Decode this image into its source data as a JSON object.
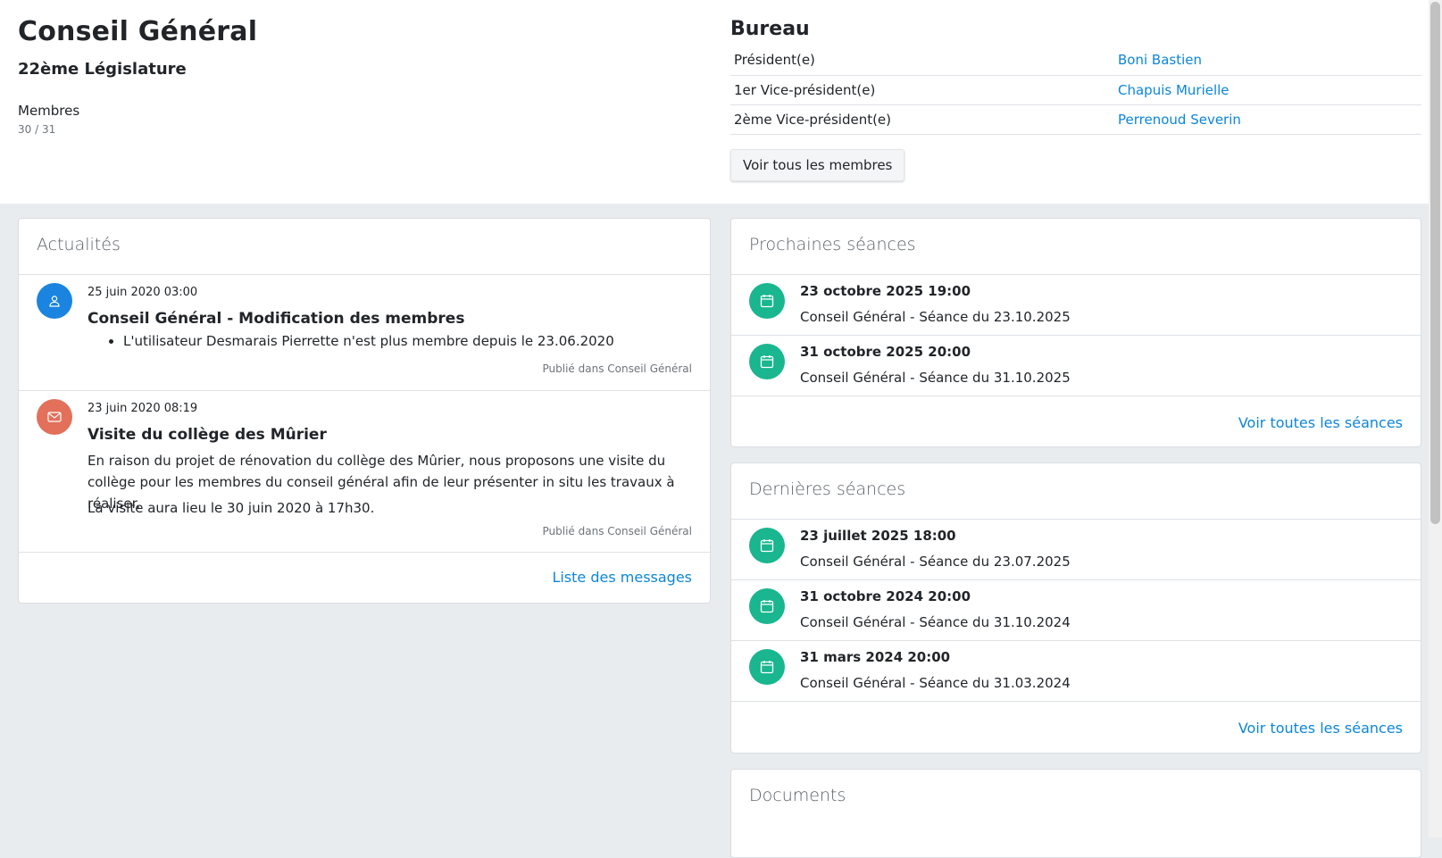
{
  "header": {
    "title": "Conseil Général",
    "legislature": "22ème Législature",
    "members_label": "Membres",
    "members_count": "30 / 31"
  },
  "bureau": {
    "title": "Bureau",
    "rows": [
      {
        "role": "Président(e)",
        "name": "Boni Bastien"
      },
      {
        "role": "1er Vice-président(e)",
        "name": "Chapuis Murielle"
      },
      {
        "role": "2ème Vice-président(e)",
        "name": "Perrenoud Severin"
      }
    ],
    "all_members_button": "Voir tous les membres"
  },
  "news": {
    "title": "Actualités",
    "items": [
      {
        "icon": "user-icon",
        "date": "25 juin 2020 03:00",
        "title": "Conseil Général - Modification des membres",
        "bullet": "L'utilisateur Desmarais Pierrette n'est plus membre depuis le 23.06.2020",
        "published": "Publié dans Conseil Général"
      },
      {
        "icon": "envelope-icon",
        "date": "23 juin 2020 08:19",
        "title": "Visite du collège des Mûrier",
        "text": "En raison du projet de rénovation du collège des Mûrier, nous proposons une visite du collège pour les membres du conseil général afin de leur présenter in situ les travaux à réaliser.",
        "text2": "La visite aura lieu le 30 juin 2020 à 17h30.",
        "published": "Publié dans Conseil Général"
      }
    ],
    "footer_link": "Liste des messages"
  },
  "upcoming": {
    "title": "Prochaines séances",
    "items": [
      {
        "date": "23 octobre 2025 19:00",
        "name": "Conseil Général - Séance du 23.10.2025"
      },
      {
        "date": "31 octobre 2025 20:00",
        "name": "Conseil Général - Séance du 31.10.2025"
      }
    ],
    "footer_link": "Voir toutes les séances"
  },
  "past": {
    "title": "Dernières séances",
    "items": [
      {
        "date": "23 juillet 2025 18:00",
        "name": "Conseil Général - Séance du 23.07.2025"
      },
      {
        "date": "31 octobre 2024 20:00",
        "name": "Conseil Général - Séance du 31.10.2024"
      },
      {
        "date": "31 mars 2024 20:00",
        "name": "Conseil Général - Séance du 31.03.2024"
      }
    ],
    "footer_link": "Voir toutes les séances"
  },
  "documents": {
    "title": "Documents"
  },
  "colors": {
    "link": "#0d86d8",
    "session_icon": "#19b68f",
    "user_avatar": "#1a84e0",
    "message_avatar": "#e2705a"
  }
}
